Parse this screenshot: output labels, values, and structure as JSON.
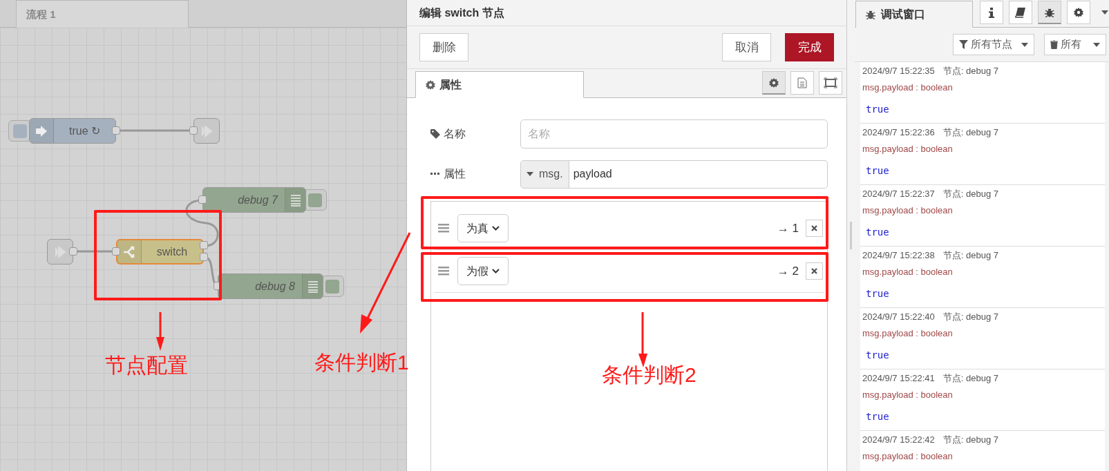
{
  "canvas": {
    "tabs": [
      {
        "label": "流程 1",
        "selected": true
      }
    ],
    "nodes": [
      {
        "kind": "inject",
        "label": "true ↻"
      },
      {
        "kind": "link"
      },
      {
        "kind": "debug",
        "label": "debug 7"
      },
      {
        "kind": "link"
      },
      {
        "kind": "switch",
        "label": "switch",
        "selected": true
      },
      {
        "kind": "debug",
        "label": "debug 8"
      }
    ]
  },
  "editor": {
    "title": "编辑 switch 节点",
    "buttons": [
      {
        "label": "删除",
        "kind": "plain"
      },
      {
        "label": "取消",
        "kind": "plain"
      },
      {
        "label": "完成",
        "kind": "primary"
      }
    ],
    "tabs": [
      {
        "label": "属性",
        "selected": true
      }
    ],
    "tab_icons": [
      {
        "selected": true
      },
      {
        "selected": false
      },
      {
        "selected": false
      }
    ],
    "fields": [
      {
        "label": "名称",
        "placeholder": "名称"
      },
      {
        "label": "属性",
        "prefix": "msg.",
        "value": "payload"
      }
    ],
    "rules": [
      {
        "operator": "为真",
        "output": "→ 1"
      },
      {
        "operator": "为假",
        "output": "→ 2"
      }
    ]
  },
  "debug": {
    "tabs": [
      {
        "label": "调试窗口",
        "selected": true
      }
    ],
    "icon_buttons": [
      {
        "selected": false
      },
      {
        "selected": false
      },
      {
        "selected": true
      },
      {
        "selected": false
      }
    ],
    "filters": [
      "所有节点",
      "所有"
    ],
    "messages": [
      {
        "time": "2024/9/7 15:22:35",
        "node": "节点: debug 7",
        "type": "msg.payload : boolean",
        "value": "true"
      },
      {
        "time": "2024/9/7 15:22:36",
        "node": "节点: debug 7",
        "type": "msg.payload : boolean",
        "value": "true"
      },
      {
        "time": "2024/9/7 15:22:37",
        "node": "节点: debug 7",
        "type": "msg.payload : boolean",
        "value": "true"
      },
      {
        "time": "2024/9/7 15:22:38",
        "node": "节点: debug 7",
        "type": "msg.payload : boolean",
        "value": "true"
      },
      {
        "time": "2024/9/7 15:22:40",
        "node": "节点: debug 7",
        "type": "msg.payload : boolean",
        "value": "true"
      },
      {
        "time": "2024/9/7 15:22:41",
        "node": "节点: debug 7",
        "type": "msg.payload : boolean",
        "value": "true"
      },
      {
        "time": "2024/9/7 15:22:42",
        "node": "节点: debug 7",
        "type": "msg.payload : boolean"
      }
    ]
  },
  "annotations": [
    {
      "text": "节点配置"
    },
    {
      "text": "条件判断1"
    },
    {
      "text": "条件判断2"
    }
  ]
}
